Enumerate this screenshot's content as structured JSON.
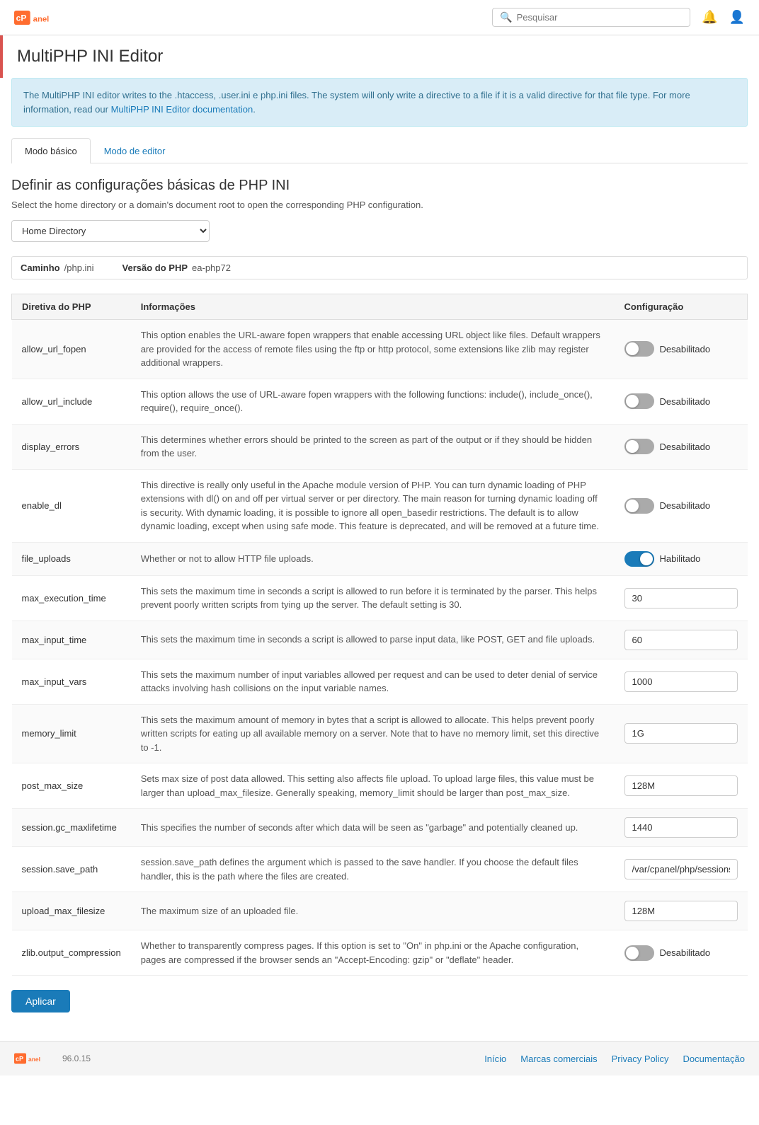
{
  "header": {
    "search_placeholder": "Pesquisar"
  },
  "page": {
    "title": "MultiPHP INI Editor",
    "info_text_1": "The MultiPHP INI editor writes to the .htaccess, .user.ini e php.ini files. The system will only write a directive to a file if it is a valid directive for that file type. For more information, read our ",
    "info_link_text": "MultiPHP INI Editor documentation",
    "info_text_2": "."
  },
  "tabs": [
    {
      "label": "Modo básico",
      "active": true
    },
    {
      "label": "Modo de editor",
      "active": false
    }
  ],
  "section": {
    "title": "Definir as configurações básicas de PHP INI",
    "description": "Select the home directory or a domain's document root to open the corresponding PHP configuration."
  },
  "dropdown": {
    "selected": "Home Directory",
    "options": [
      "Home Directory"
    ]
  },
  "path_bar": {
    "path_label": "Caminho",
    "path_value": "/php.ini",
    "version_label": "Versão do PHP",
    "version_value": "ea-php72"
  },
  "table": {
    "headers": [
      "Diretiva do PHP",
      "Informações",
      "Configuração"
    ],
    "rows": [
      {
        "directive": "allow_url_fopen",
        "info": "This option enables the URL-aware fopen wrappers that enable accessing URL object like files. Default wrappers are provided for the access of remote files using the ftp or http protocol, some extensions like zlib may register additional wrappers.",
        "type": "toggle",
        "value": false,
        "label": "Desabilitado"
      },
      {
        "directive": "allow_url_include",
        "info": "This option allows the use of URL-aware fopen wrappers with the following functions: include(), include_once(), require(), require_once().",
        "type": "toggle",
        "value": false,
        "label": "Desabilitado"
      },
      {
        "directive": "display_errors",
        "info": "This determines whether errors should be printed to the screen as part of the output or if they should be hidden from the user.",
        "type": "toggle",
        "value": false,
        "label": "Desabilitado"
      },
      {
        "directive": "enable_dl",
        "info": "This directive is really only useful in the Apache module version of PHP. You can turn dynamic loading of PHP extensions with dl() on and off per virtual server or per directory. The main reason for turning dynamic loading off is security. With dynamic loading, it is possible to ignore all open_basedir restrictions. The default is to allow dynamic loading, except when using safe mode. This feature is deprecated, and will be removed at a future time.",
        "type": "toggle",
        "value": false,
        "label": "Desabilitado"
      },
      {
        "directive": "file_uploads",
        "info": "Whether or not to allow HTTP file uploads.",
        "type": "toggle",
        "value": true,
        "label": "Habilitado"
      },
      {
        "directive": "max_execution_time",
        "info": "This sets the maximum time in seconds a script is allowed to run before it is terminated by the parser. This helps prevent poorly written scripts from tying up the server. The default setting is 30.",
        "type": "input",
        "value": "30"
      },
      {
        "directive": "max_input_time",
        "info": "This sets the maximum time in seconds a script is allowed to parse input data, like POST, GET and file uploads.",
        "type": "input",
        "value": "60"
      },
      {
        "directive": "max_input_vars",
        "info": "This sets the maximum number of input variables allowed per request and can be used to deter denial of service attacks involving hash collisions on the input variable names.",
        "type": "input",
        "value": "1000"
      },
      {
        "directive": "memory_limit",
        "info": "This sets the maximum amount of memory in bytes that a script is allowed to allocate. This helps prevent poorly written scripts for eating up all available memory on a server. Note that to have no memory limit, set this directive to -1.",
        "type": "input",
        "value": "1G"
      },
      {
        "directive": "post_max_size",
        "info": "Sets max size of post data allowed. This setting also affects file upload. To upload large files, this value must be larger than upload_max_filesize. Generally speaking, memory_limit should be larger than post_max_size.",
        "type": "input",
        "value": "128M"
      },
      {
        "directive": "session.gc_maxlifetime",
        "info": "This specifies the number of seconds after which data will be seen as \"garbage\" and potentially cleaned up.",
        "type": "input",
        "value": "1440"
      },
      {
        "directive": "session.save_path",
        "info": "session.save_path defines the argument which is passed to the save handler. If you choose the default files handler, this is the path where the files are created.",
        "type": "input",
        "value": "/var/cpanel/php/sessions/"
      },
      {
        "directive": "upload_max_filesize",
        "info": "The maximum size of an uploaded file.",
        "type": "input",
        "value": "128M"
      },
      {
        "directive": "zlib.output_compression",
        "info": "Whether to transparently compress pages. If this option is set to \"On\" in php.ini or the Apache configuration, pages are compressed if the browser sends an \"Accept-Encoding: gzip\" or \"deflate\" header.",
        "type": "toggle",
        "value": false,
        "label": "Desabilitado"
      }
    ]
  },
  "apply_button": "Aplicar",
  "footer": {
    "version": "96.0.15",
    "links": [
      {
        "label": "Início"
      },
      {
        "label": "Marcas comerciais"
      },
      {
        "label": "Privacy Policy"
      },
      {
        "label": "Documentação"
      }
    ]
  }
}
